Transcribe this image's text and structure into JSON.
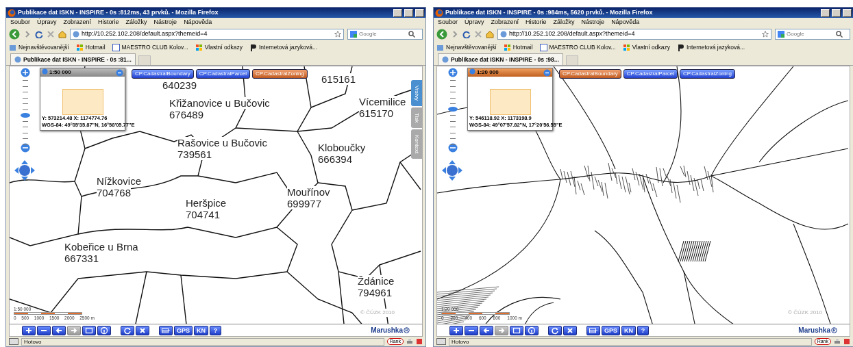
{
  "windows": [
    {
      "title": "Publikace dat ISKN - INSPIRE - 0s :812ms, 43 prvků. - Mozilla Firefox",
      "menu": [
        "Soubor",
        "Úpravy",
        "Zobrazení",
        "Historie",
        "Záložky",
        "Nástroje",
        "Nápověda"
      ],
      "url": "http://10.252.102.208/default.aspx?themeid=4",
      "search": {
        "placeholder": "Google"
      },
      "bookmarks": [
        "Nejnavštěvovanější",
        "Hotmail",
        "MAESTRO CLUB Kolov...",
        "Vlastní odkazy",
        "Internetová jazyková..."
      ],
      "tab": "Publikace dat ISKN - INSPIRE - 0s :81...",
      "map": {
        "kind": "boundaries",
        "zoom_slider": {
          "level": 0.44
        },
        "overview": {
          "scale": "1:50 000",
          "active": false,
          "coords": "Y: 573214.48 X: 1174774.76",
          "wgs": "WGS-84: 49°05'35.87\"N, 16°58'05.77\"E"
        },
        "layers": [
          {
            "label": "CP.CadastralBoundary",
            "selected": false
          },
          {
            "label": "CP.CadastralParcel",
            "selected": false
          },
          {
            "label": "CP.CadastralZoning",
            "selected": true
          }
        ],
        "side_tabs": [
          {
            "label": "Vrstvy",
            "selected": true
          },
          {
            "label": "Tisk",
            "selected": false
          },
          {
            "label": "Kontext",
            "selected": false
          }
        ],
        "labels": [
          {
            "code": "640239"
          },
          {
            "name": "Křižanovice u Bučovic",
            "code": "676489"
          },
          {
            "code": "615161"
          },
          {
            "name": "Vícemilice",
            "code": "615170"
          },
          {
            "name": "Rašovice u Bučovic",
            "code": "739561"
          },
          {
            "name": "Kloboučky",
            "code": "666394"
          },
          {
            "name": "Nížkovice",
            "code": "704768"
          },
          {
            "name": "Heršpice",
            "code": "704741"
          },
          {
            "name": "Mouřínov",
            "code": "699977"
          },
          {
            "name": "Kobeřice u Brna",
            "code": "667331"
          },
          {
            "name": "Ždánice",
            "code": "794961"
          }
        ],
        "scale_bar": {
          "label": "1:50 000",
          "ticks": [
            "0",
            "500",
            "1000",
            "1500",
            "2000",
            "2500 m"
          ]
        },
        "copyright": "© ČÚZK 2010"
      },
      "toolbar": [
        [
          {
            "kind": "zoom-in",
            "disabled": false
          },
          {
            "kind": "zoom-out",
            "disabled": false
          },
          {
            "kind": "back",
            "disabled": false
          },
          {
            "kind": "forward",
            "disabled": true
          },
          {
            "kind": "zoom-rect",
            "disabled": false
          },
          {
            "kind": "info",
            "disabled": false
          }
        ],
        [
          {
            "kind": "refresh",
            "disabled": false
          },
          {
            "kind": "clear",
            "disabled": false
          }
        ],
        [
          {
            "kind": "scale",
            "disabled": false
          },
          {
            "kind": "text",
            "label": "GPS",
            "disabled": false
          },
          {
            "kind": "text",
            "label": "KN",
            "disabled": false
          },
          {
            "kind": "text",
            "label": "?",
            "disabled": false
          }
        ]
      ],
      "brand": "Marushka",
      "status": "Hotovo",
      "rank": "Rank"
    },
    {
      "title": "Publikace dat ISKN - INSPIRE - 0s :984ms, 5620 prvků. - Mozilla Firefox",
      "menu": [
        "Soubor",
        "Úpravy",
        "Zobrazení",
        "Historie",
        "Záložky",
        "Nástroje",
        "Nápověda"
      ],
      "url": "http://10.252.102.208/default.aspx?themeid=4",
      "search": {
        "placeholder": "Google"
      },
      "bookmarks": [
        "Nejnavštěvovanější",
        "Hotmail",
        "MAESTRO CLUB Kolov...",
        "Vlastní odkazy",
        "Internetová jazyková..."
      ],
      "tab": "Publikace dat ISKN - INSPIRE - 0s :98...",
      "map": {
        "kind": "parcels",
        "zoom_slider": {
          "level": 0.53
        },
        "overview": {
          "scale": "1:20 000",
          "active": true,
          "coords": "Y: 546118.92 X: 1173198.9",
          "wgs": "WGS-84: 49°07'57.82\"N, 17°20'56.55\"E"
        },
        "layers": [
          {
            "label": "CP.CadastralBoundary",
            "selected": true
          },
          {
            "label": "CP.CadastralParcel",
            "selected": false
          },
          {
            "label": "CP.CadastralZoning",
            "selected": false
          }
        ],
        "scale_bar": {
          "label": "1:20 000",
          "ticks": [
            "0",
            "200",
            "400",
            "600",
            "800",
            "1000 m"
          ]
        },
        "copyright": "© ČÚZK 2010"
      },
      "toolbar": [
        [
          {
            "kind": "zoom-in",
            "disabled": false
          },
          {
            "kind": "zoom-out",
            "disabled": false
          },
          {
            "kind": "back",
            "disabled": false
          },
          {
            "kind": "forward",
            "disabled": true
          },
          {
            "kind": "zoom-rect",
            "disabled": false
          },
          {
            "kind": "info",
            "disabled": false
          }
        ],
        [
          {
            "kind": "refresh",
            "disabled": false
          },
          {
            "kind": "clear",
            "disabled": false
          }
        ],
        [
          {
            "kind": "scale",
            "disabled": false
          },
          {
            "kind": "text",
            "label": "GPS",
            "disabled": false
          },
          {
            "kind": "text",
            "label": "KN",
            "disabled": false
          },
          {
            "kind": "text",
            "label": "?",
            "disabled": false
          }
        ]
      ],
      "brand": "Marushka",
      "status": "Hotovo",
      "rank": "Rank"
    }
  ]
}
